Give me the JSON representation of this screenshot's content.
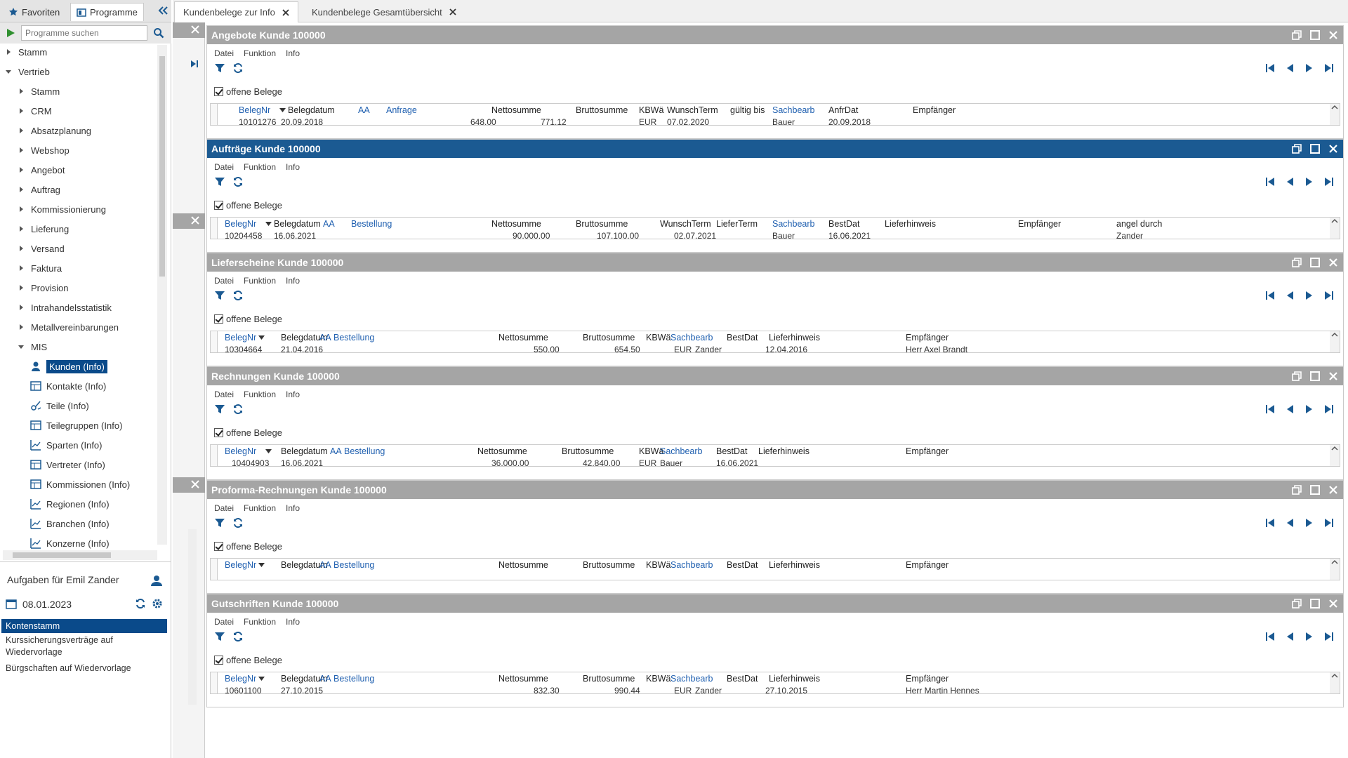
{
  "sidebar": {
    "tabs": [
      "Favoriten",
      "Programme"
    ],
    "search_placeholder": "Programme suchen",
    "tree": [
      {
        "label": "Stamm",
        "level": 0,
        "expanded": false
      },
      {
        "label": "Vertrieb",
        "level": 0,
        "expanded": true
      },
      {
        "label": "Stamm",
        "level": 1
      },
      {
        "label": "CRM",
        "level": 1
      },
      {
        "label": "Absatzplanung",
        "level": 1
      },
      {
        "label": "Webshop",
        "level": 1
      },
      {
        "label": "Angebot",
        "level": 1
      },
      {
        "label": "Auftrag",
        "level": 1
      },
      {
        "label": "Kommissionierung",
        "level": 1
      },
      {
        "label": "Lieferung",
        "level": 1
      },
      {
        "label": "Versand",
        "level": 1
      },
      {
        "label": "Faktura",
        "level": 1
      },
      {
        "label": "Provision",
        "level": 1
      },
      {
        "label": "Intrahandelsstatistik",
        "level": 1
      },
      {
        "label": "Metallvereinbarungen",
        "level": 1
      },
      {
        "label": "MIS",
        "level": 1,
        "expanded": true
      },
      {
        "label": "Kunden (Info)",
        "level": 2,
        "selected": true,
        "icon": "person-icon"
      },
      {
        "label": "Kontakte (Info)",
        "level": 2,
        "icon": "table-icon"
      },
      {
        "label": "Teile (Info)",
        "level": 2,
        "icon": "parts-icon"
      },
      {
        "label": "Teilegruppen (Info)",
        "level": 2,
        "icon": "table-icon"
      },
      {
        "label": "Sparten (Info)",
        "level": 2,
        "icon": "chart-icon"
      },
      {
        "label": "Vertreter (Info)",
        "level": 2,
        "icon": "table-icon"
      },
      {
        "label": "Kommissionen (Info)",
        "level": 2,
        "icon": "table-icon"
      },
      {
        "label": "Regionen (Info)",
        "level": 2,
        "icon": "chart-icon"
      },
      {
        "label": "Branchen (Info)",
        "level": 2,
        "icon": "chart-icon"
      },
      {
        "label": "Konzerne (Info)",
        "level": 2,
        "icon": "chart-icon"
      }
    ],
    "tasks_title": "Aufgaben für Emil Zander",
    "date": "08.01.2023",
    "tasks": [
      {
        "label": "Kontenstamm",
        "selected": true
      },
      {
        "label": "Kurssicherungsverträge auf Wiedervorlage"
      },
      {
        "label": "Bürgschaften auf Wiedervorlage"
      }
    ]
  },
  "main_tabs": [
    {
      "label": "Kundenbelege zur Info",
      "active": true
    },
    {
      "label": "Kundenbelege Gesamtübersicht",
      "active": false
    }
  ],
  "colors": {
    "active_title": "#1b5a92",
    "inactive_title": "#a5a5a5",
    "link": "#2060b0",
    "selection": "#0a4a8a"
  },
  "panels": [
    {
      "title": "Angebote Kunde 100000",
      "active": false,
      "menu": [
        "Datei",
        "Funktion",
        "Info"
      ],
      "checkbox": "offene Belege",
      "headers": [
        "BelegNr",
        "Belegdatum",
        "AA",
        "Anfrage",
        "Nettosumme",
        "Bruttosumme",
        "KBWä",
        "WunschTerm",
        "gültig bis",
        "Sachbearb",
        "AnfrDat",
        "Empfänger"
      ],
      "row": [
        "10101276",
        "20.09.2018",
        "",
        "",
        "648,00",
        "771,12",
        "EUR",
        "07.02.2020",
        "",
        "Bauer",
        "20.09.2018",
        ""
      ]
    },
    {
      "title": "Aufträge Kunde 100000",
      "active": true,
      "menu": [
        "Datei",
        "Funktion",
        "Info"
      ],
      "checkbox": "offene Belege",
      "headers": [
        "BelegNr",
        "Belegdatum",
        "AA",
        "Bestellung",
        "Nettosumme",
        "Bruttosumme",
        "WunschTerm",
        "LieferTerm",
        "Sachbearb",
        "BestDat",
        "Lieferhinweis",
        "Empfänger",
        "angel durch"
      ],
      "row": [
        "10204458",
        "16.06.2021",
        "",
        "",
        "90.000,00",
        "107.100,00",
        "02.07.2021",
        "",
        "Bauer",
        "16.06.2021",
        "",
        "",
        "Zander"
      ]
    },
    {
      "title": "Lieferscheine Kunde 100000",
      "active": false,
      "menu": [
        "Datei",
        "Funktion",
        "Info"
      ],
      "checkbox": "offene Belege",
      "headers": [
        "BelegNr",
        "Belegdatum",
        "AA",
        "Bestellung",
        "Nettosumme",
        "Bruttosumme",
        "KBWä",
        "Sachbearb",
        "BestDat",
        "Lieferhinweis",
        "Empfänger"
      ],
      "row": [
        "10304664",
        "21.04.2016",
        "",
        "",
        "550,00",
        "654,50",
        "EUR",
        "Zander",
        "12.04.2016",
        "",
        "Herr Axel Brandt"
      ]
    },
    {
      "title": "Rechnungen Kunde 100000",
      "active": false,
      "menu": [
        "Datei",
        "Funktion",
        "Info"
      ],
      "checkbox": "offene Belege",
      "headers": [
        "BelegNr",
        "Belegdatum",
        "AA",
        "Bestellung",
        "Nettosumme",
        "Bruttosumme",
        "KBWä",
        "Sachbearb",
        "BestDat",
        "Lieferhinweis",
        "Empfänger"
      ],
      "row": [
        "10404903",
        "16.06.2021",
        "",
        "",
        "36.000,00",
        "42.840,00",
        "EUR",
        "Bauer",
        "16.06.2021",
        "",
        ""
      ]
    },
    {
      "title": "Proforma-Rechnungen Kunde 100000",
      "active": false,
      "menu": [
        "Datei",
        "Funktion",
        "Info"
      ],
      "checkbox": "offene Belege",
      "headers": [
        "BelegNr",
        "Belegdatum",
        "AA",
        "Bestellung",
        "Nettosumme",
        "Bruttosumme",
        "KBWä",
        "Sachbearb",
        "BestDat",
        "Lieferhinweis",
        "Empfänger"
      ],
      "row": []
    },
    {
      "title": "Gutschriften Kunde 100000",
      "active": false,
      "menu": [
        "Datei",
        "Funktion",
        "Info"
      ],
      "checkbox": "offene Belege",
      "headers": [
        "BelegNr",
        "Belegdatum",
        "AA",
        "Bestellung",
        "Nettosumme",
        "Bruttosumme",
        "KBWä",
        "Sachbearb",
        "BestDat",
        "Lieferhinweis",
        "Empfänger"
      ],
      "row": [
        "10601100",
        "27.10.2015",
        "",
        "",
        "832,30",
        "990,44",
        "EUR",
        "Zander",
        "27.10.2015",
        "",
        "Herr Martin Hennes"
      ]
    }
  ]
}
